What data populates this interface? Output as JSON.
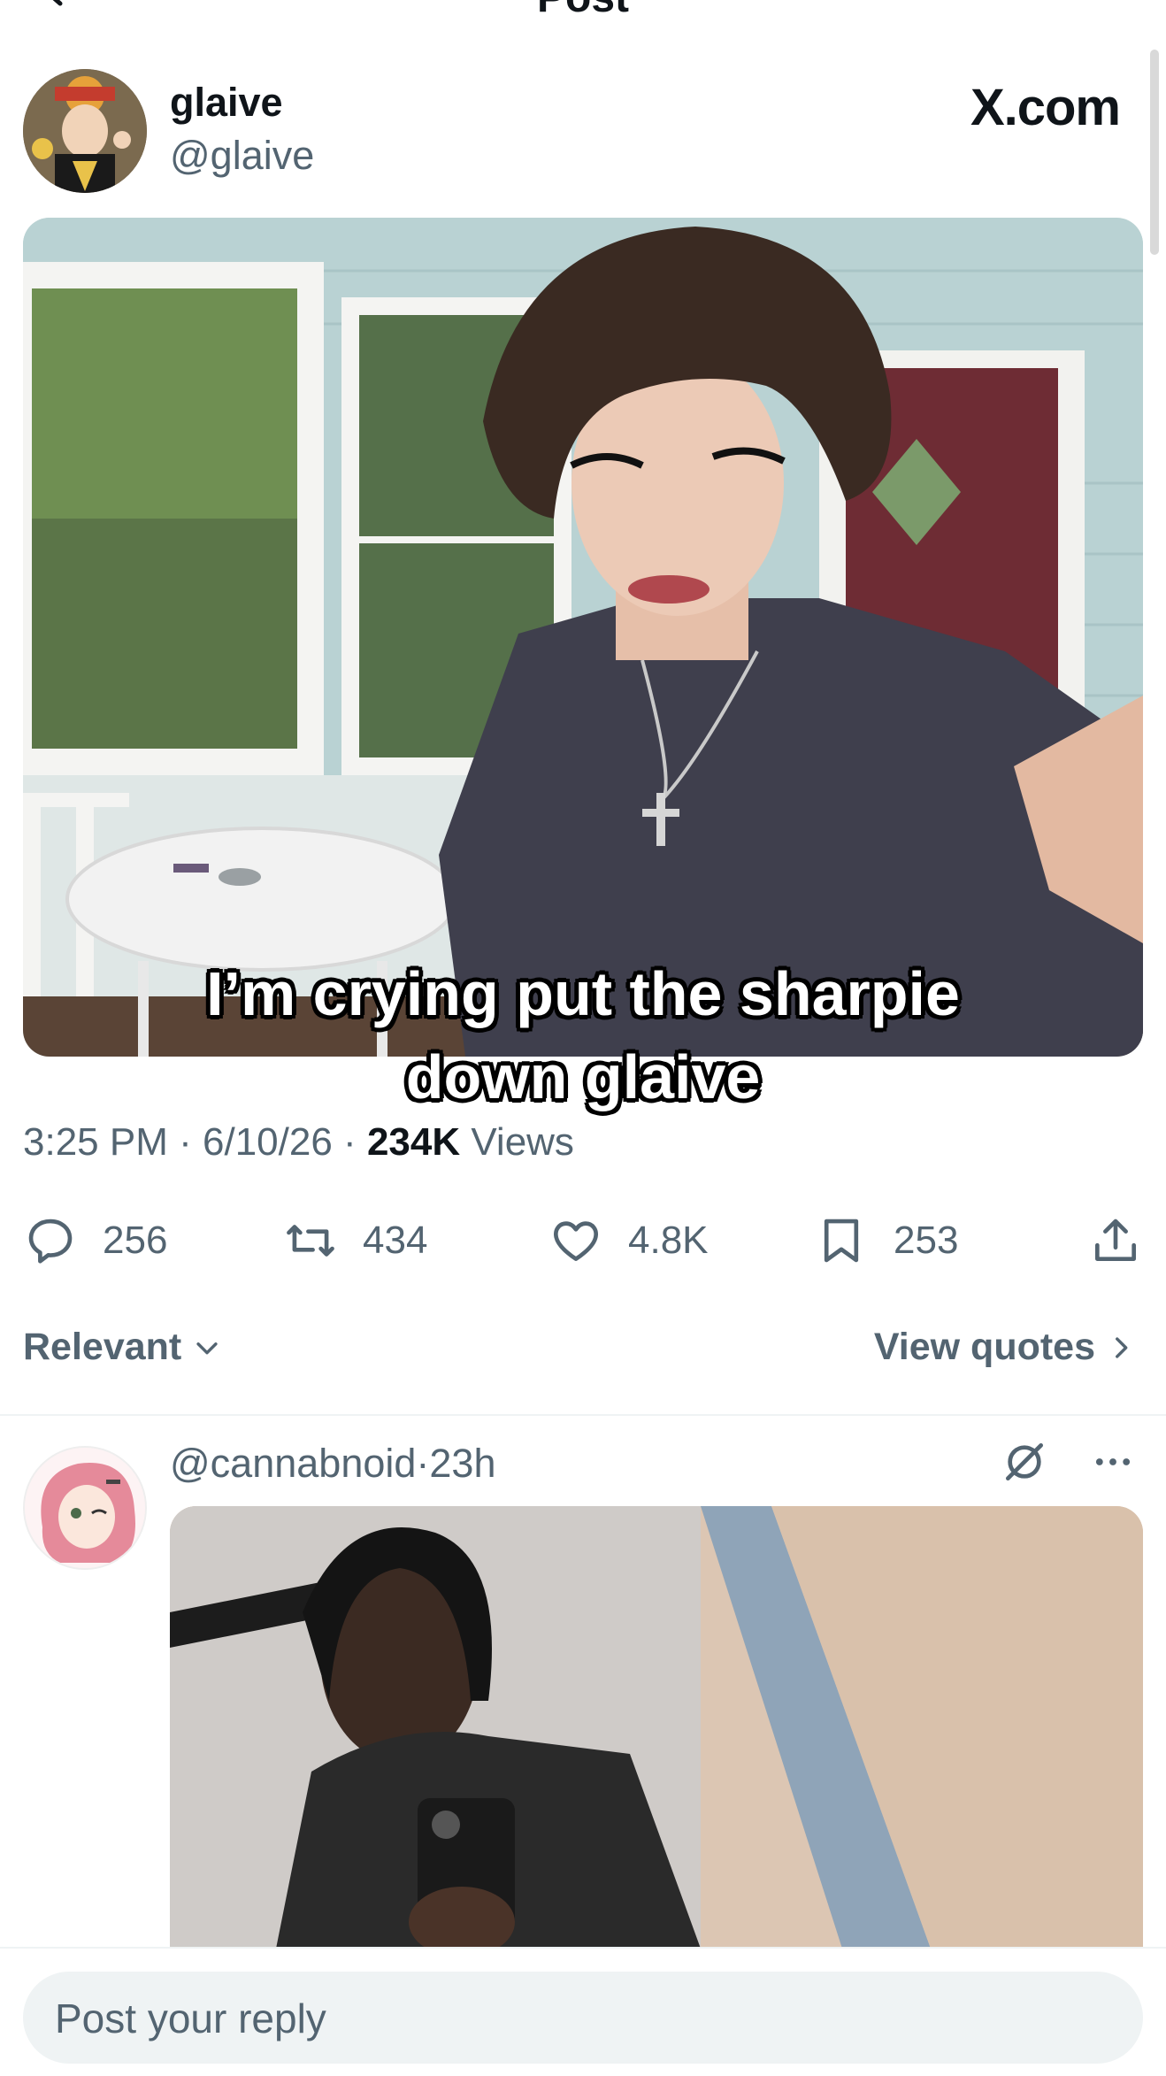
{
  "topbar": {
    "title": "Post"
  },
  "post": {
    "author_name": "glaive",
    "author_handle": "@glaive",
    "watermark": "X.com",
    "caption_line1": "I’m crying put the sharpie",
    "caption_line2": "down glaive",
    "time": "3:25 PM",
    "date": "6/10/26",
    "views_count": "234K",
    "views_label": "Views",
    "separator": "·"
  },
  "actions": {
    "replies": "256",
    "reposts": "434",
    "likes": "4.8K",
    "bookmarks": "253"
  },
  "sort": {
    "label": "Relevant",
    "quotes_label": "View quotes"
  },
  "reply": {
    "handle": "@cannabnoid",
    "separator": "·",
    "age": "23h"
  },
  "composer": {
    "placeholder": "Post your reply"
  },
  "colors": {
    "text_primary": "#0f1419",
    "text_secondary": "#536471",
    "divider": "#eff3f4",
    "input_bg": "#eff3f4"
  }
}
